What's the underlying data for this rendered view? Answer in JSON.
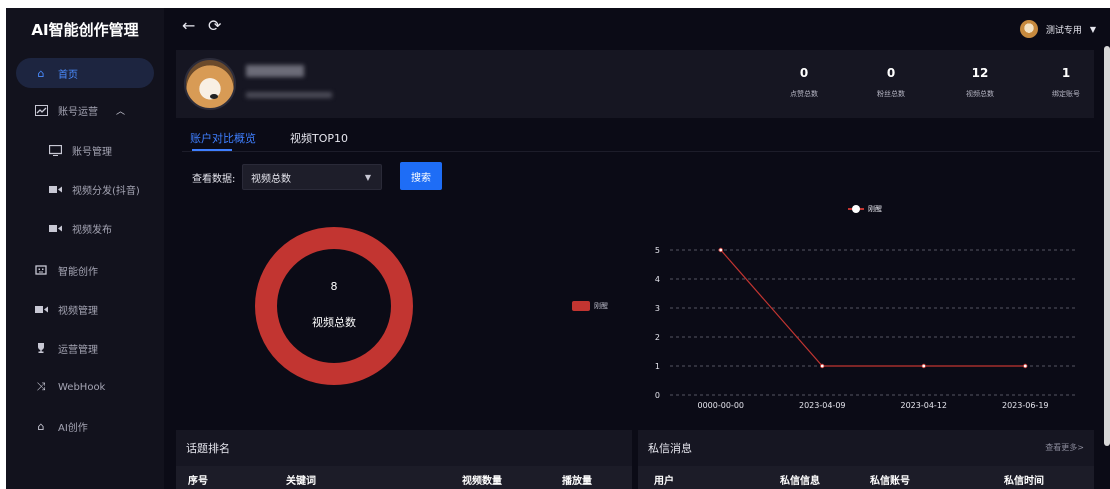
{
  "app": {
    "title": "AI智能创作管理"
  },
  "sidebar": {
    "items": [
      {
        "label": "首页",
        "icon": "home-icon",
        "active": true
      },
      {
        "label": "账号运营",
        "icon": "chart-icon",
        "expanded": true
      },
      {
        "label": "账号管理",
        "icon": "monitor-icon",
        "sub": true
      },
      {
        "label": "视频分发(抖音)",
        "icon": "video-icon",
        "sub": true
      },
      {
        "label": "视频发布",
        "icon": "video-icon",
        "sub": true
      },
      {
        "label": "智能创作",
        "icon": "robot-icon"
      },
      {
        "label": "视频管理",
        "icon": "video-icon"
      },
      {
        "label": "运营管理",
        "icon": "trophy-icon"
      },
      {
        "label": "WebHook",
        "icon": "shuffle-icon"
      },
      {
        "label": "AI创作",
        "icon": "home-icon"
      }
    ]
  },
  "header": {
    "user_name": "测试专用"
  },
  "profile": {
    "stats": [
      {
        "value": "0",
        "label": "点赞总数"
      },
      {
        "value": "0",
        "label": "粉丝总数"
      },
      {
        "value": "12",
        "label": "视频总数"
      },
      {
        "value": "1",
        "label": "绑定账号"
      }
    ]
  },
  "tabs": [
    {
      "label": "账户对比概览",
      "active": true
    },
    {
      "label": "视频TOP10",
      "active": false
    }
  ],
  "filter": {
    "label": "查看数据:",
    "selected": "视频总数",
    "button": "搜索"
  },
  "donut": {
    "value": "8",
    "label": "视频总数",
    "legend": "刚醒",
    "color": "#c23531"
  },
  "chart_data": {
    "type": "line",
    "series": [
      {
        "name": "刚醒",
        "values": [
          5,
          1,
          1,
          1
        ]
      }
    ],
    "categories": [
      "0000-00-00",
      "2023-04-09",
      "2023-04-12",
      "2023-06-19"
    ],
    "y_ticks": [
      "0",
      "1",
      "2",
      "3",
      "4",
      "5"
    ],
    "ylim": [
      0,
      5
    ],
    "grid": true,
    "legend_position": "top",
    "line_color": "#c23531"
  },
  "panels": {
    "topics": {
      "title": "话题排名",
      "columns": [
        "序号",
        "关键词",
        "视频数量",
        "播放量"
      ]
    },
    "messages": {
      "title": "私信消息",
      "more": "查看更多>",
      "columns": [
        "用户",
        "私信信息",
        "私信账号",
        "私信时间"
      ]
    }
  }
}
